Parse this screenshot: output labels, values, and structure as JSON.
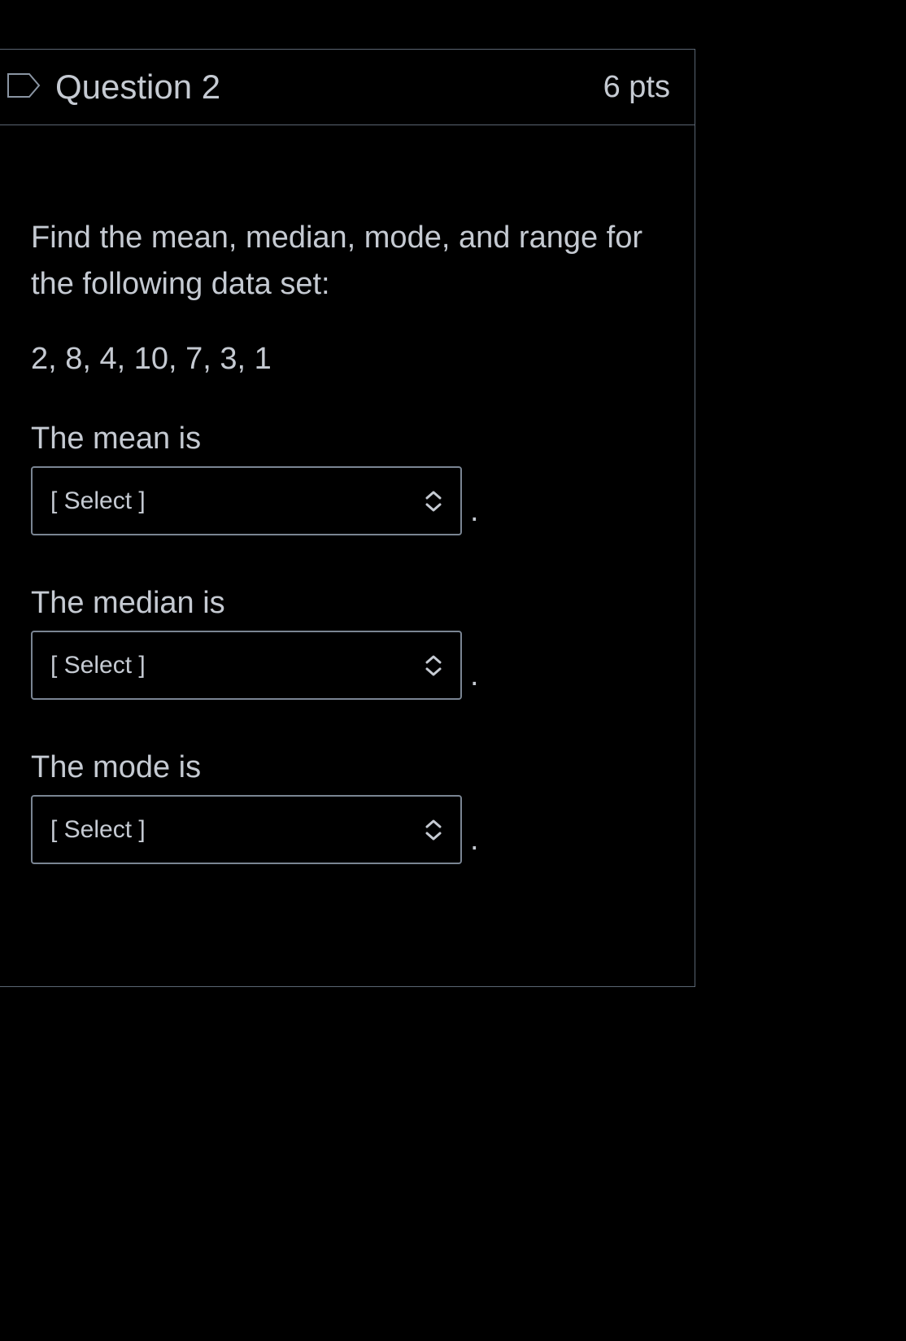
{
  "header": {
    "title": "Question 2",
    "points": "6 pts"
  },
  "body": {
    "prompt": "Find the mean, median, mode, and range for the following data set:",
    "data_set": "2, 8, 4, 10, 7, 3, 1",
    "answers": [
      {
        "label": "The mean is",
        "select_placeholder": "[ Select ]",
        "suffix": "."
      },
      {
        "label": "The median is",
        "select_placeholder": "[ Select ]",
        "suffix": "."
      },
      {
        "label": "The mode is",
        "select_placeholder": "[ Select ]",
        "suffix": "."
      }
    ]
  }
}
